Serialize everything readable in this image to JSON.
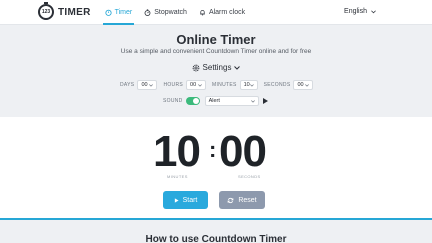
{
  "header": {
    "logo_number": "123",
    "brand": "TIMER",
    "nav": [
      {
        "label": "Timer",
        "icon": "timer-icon",
        "active": true
      },
      {
        "label": "Stopwatch",
        "icon": "stopwatch-icon",
        "active": false
      },
      {
        "label": "Alarm clock",
        "icon": "alarm-icon",
        "active": false
      }
    ],
    "language": "English"
  },
  "main": {
    "title": "Online Timer",
    "subtitle": "Use a simple and convenient Countdown Timer online and for free",
    "settings_label": "Settings"
  },
  "fields": {
    "days": {
      "label": "DAYS",
      "value": "00"
    },
    "hours": {
      "label": "HOURS",
      "value": "00"
    },
    "minutes": {
      "label": "MINUTES",
      "value": "10"
    },
    "seconds": {
      "label": "SECONDS",
      "value": "00"
    }
  },
  "sound": {
    "label": "SOUND",
    "enabled": true,
    "option": "Alert"
  },
  "display": {
    "minutes": "10",
    "seconds": "00",
    "separator": ":",
    "minutes_label": "MINUTES",
    "seconds_label": "SECONDS"
  },
  "buttons": {
    "start": "Start",
    "reset": "Reset"
  },
  "next_section": {
    "title": "How to use Countdown Timer"
  },
  "colors": {
    "accent": "#26a7d6",
    "toggle_on": "#3cba7c",
    "reset": "#8d99ad"
  }
}
